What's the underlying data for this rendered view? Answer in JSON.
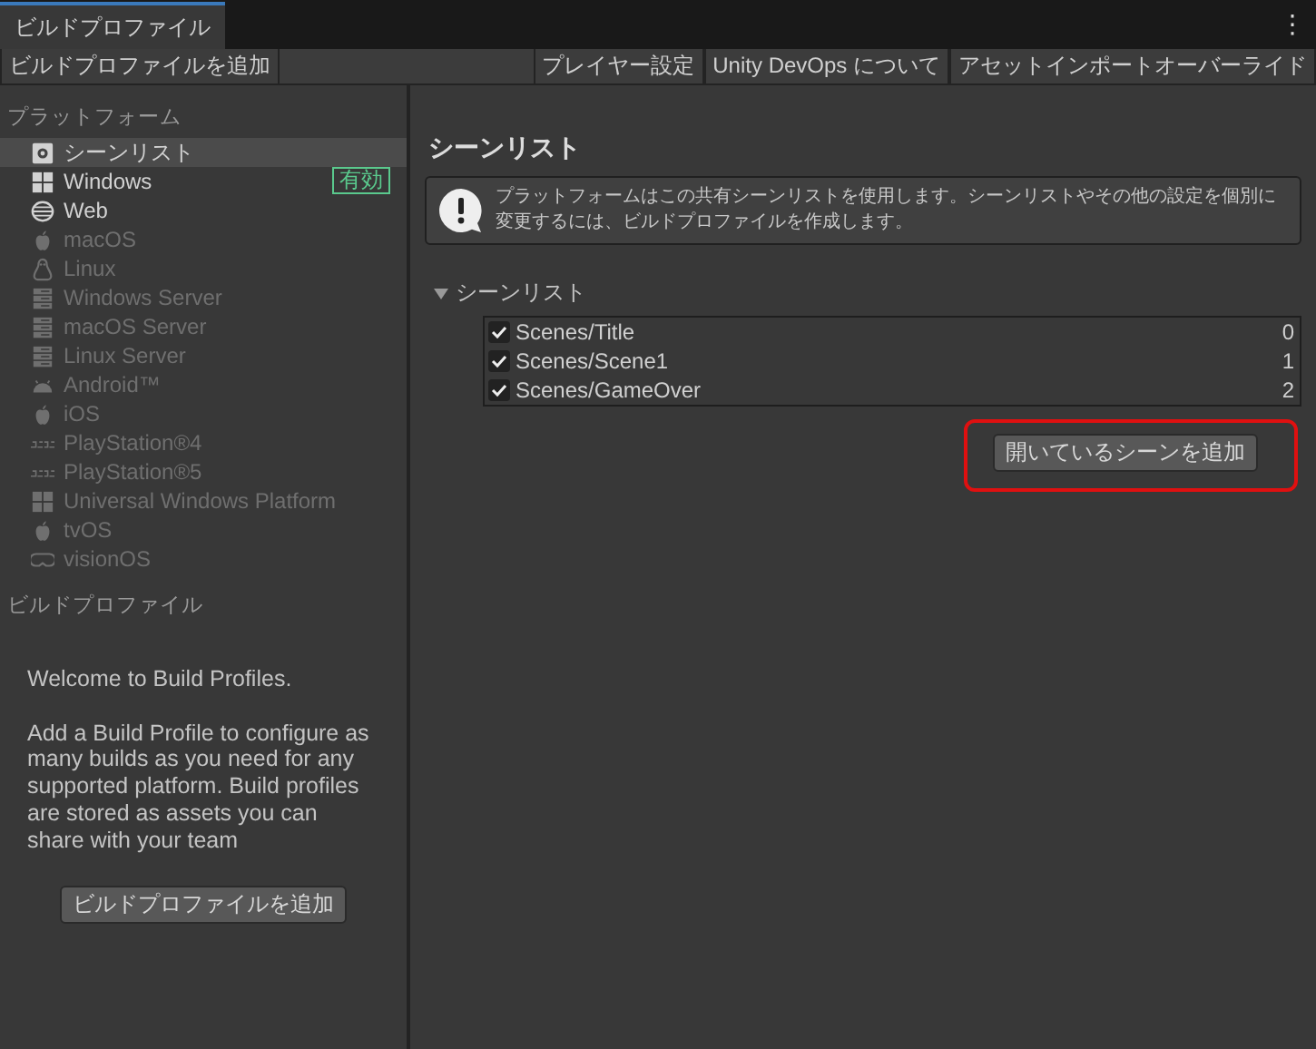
{
  "window": {
    "tab": "ビルドプロファイル",
    "menu_icon": "⋮"
  },
  "toolbar": {
    "left": [
      "ビルドプロファイルを追加"
    ],
    "right": [
      "プレイヤー設定",
      "Unity DevOps について",
      "アセットインポートオーバーライド"
    ]
  },
  "sidebar": {
    "platforms_heading": "プラットフォーム",
    "platforms": [
      {
        "name": "シーンリスト",
        "kind": "gear",
        "enabled": true,
        "selected": true
      },
      {
        "name": "Windows",
        "kind": "windows",
        "enabled": true,
        "selected": false,
        "badge": "有効"
      },
      {
        "name": "Web",
        "kind": "globe",
        "enabled": true,
        "selected": false
      },
      {
        "name": "macOS",
        "kind": "apple",
        "enabled": false,
        "selected": false
      },
      {
        "name": "Linux",
        "kind": "linux",
        "enabled": false,
        "selected": false
      },
      {
        "name": "Windows Server",
        "kind": "server",
        "enabled": false,
        "selected": false
      },
      {
        "name": "macOS Server",
        "kind": "server",
        "enabled": false,
        "selected": false
      },
      {
        "name": "Linux Server",
        "kind": "server",
        "enabled": false,
        "selected": false
      },
      {
        "name": "Android™",
        "kind": "android",
        "enabled": false,
        "selected": false
      },
      {
        "name": "iOS",
        "kind": "apple",
        "enabled": false,
        "selected": false
      },
      {
        "name": "PlayStation®4",
        "kind": "ps",
        "enabled": false,
        "selected": false
      },
      {
        "name": "PlayStation®5",
        "kind": "ps",
        "enabled": false,
        "selected": false
      },
      {
        "name": "Universal Windows Platform",
        "kind": "windows",
        "enabled": false,
        "selected": false
      },
      {
        "name": "tvOS",
        "kind": "apple",
        "enabled": false,
        "selected": false
      },
      {
        "name": "visionOS",
        "kind": "vision",
        "enabled": false,
        "selected": false
      }
    ],
    "profiles_heading": "ビルドプロファイル",
    "welcome": "Welcome to Build Profiles.",
    "description": "Add a Build Profile to configure as many builds as you need for any supported platform. Build profiles are stored as assets you can share with your team",
    "add_button": "ビルドプロファイルを追加"
  },
  "main": {
    "title": "シーンリスト",
    "info": "プラットフォームはこの共有シーンリストを使用します。シーンリストやその他の設定を個別に変更するには、ビルドプロファイルを作成します。",
    "foldout": {
      "label": "シーンリスト",
      "expanded": true
    },
    "scenes": [
      {
        "path": "Scenes/Title",
        "index": "0",
        "checked": true
      },
      {
        "path": "Scenes/Scene1",
        "index": "1",
        "checked": true
      },
      {
        "path": "Scenes/GameOver",
        "index": "2",
        "checked": true
      }
    ],
    "add_open_button": "開いているシーンを追加",
    "highlighted": true
  }
}
